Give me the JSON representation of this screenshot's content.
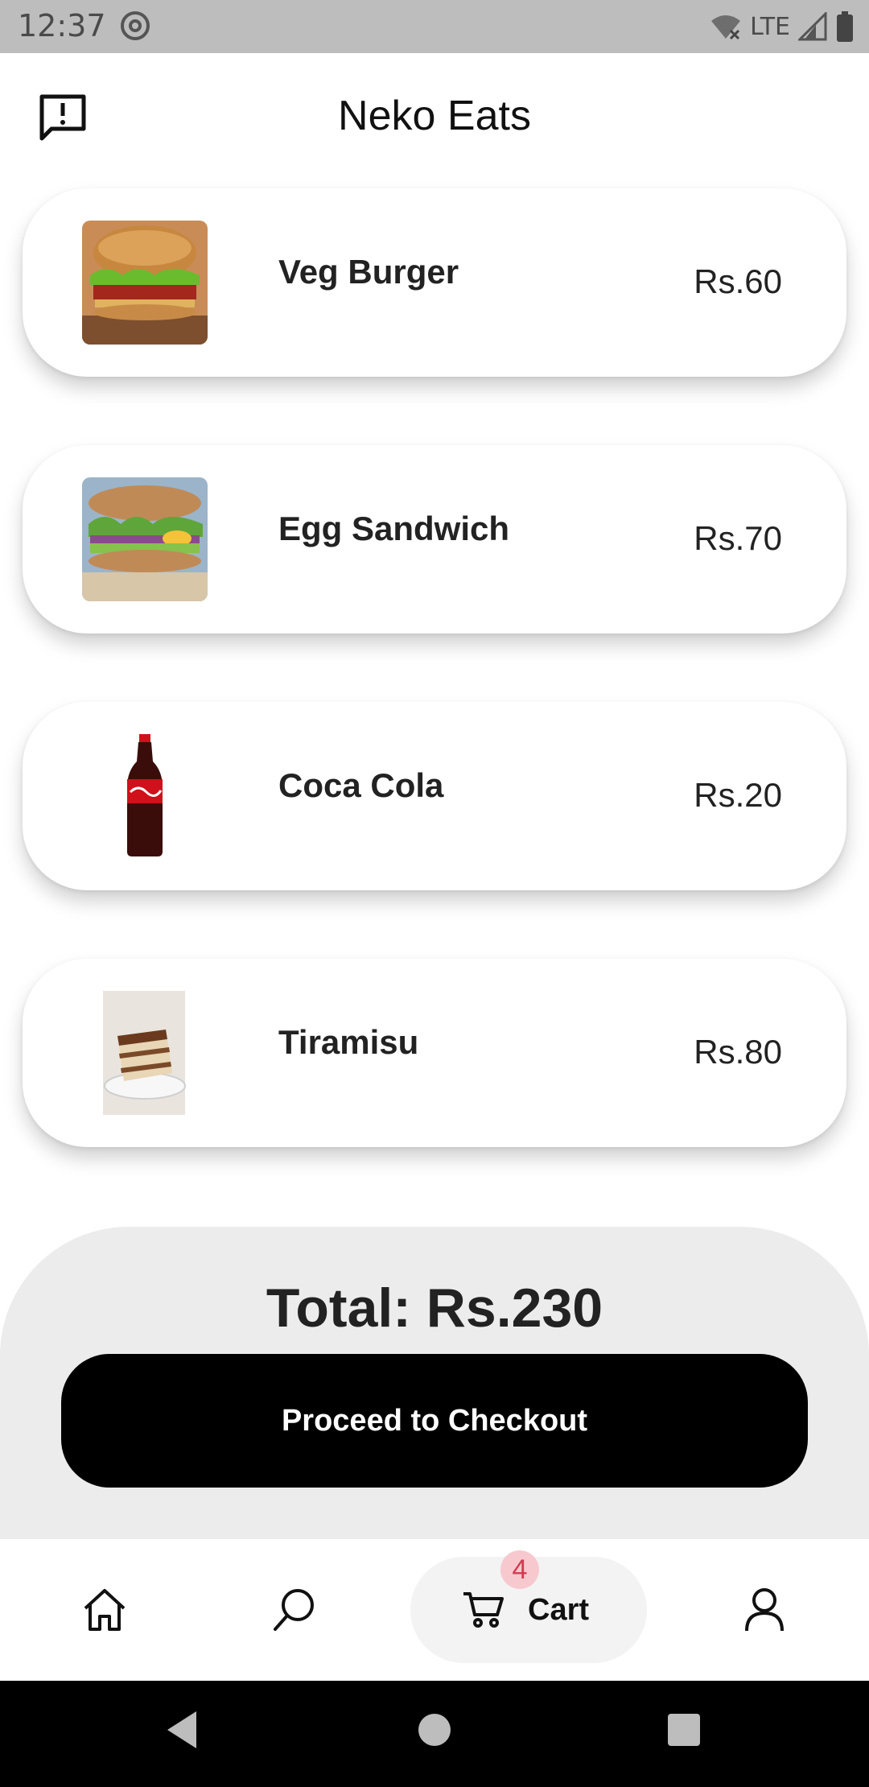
{
  "status_bar": {
    "time": "12:37",
    "network": "LTE"
  },
  "header": {
    "title": "Neko Eats",
    "feedback_icon": "feedback-icon"
  },
  "cart": {
    "items": [
      {
        "name": "Veg Burger",
        "price": "Rs.60"
      },
      {
        "name": "Egg Sandwich",
        "price": "Rs.70"
      },
      {
        "name": "Coca Cola",
        "price": "Rs.20"
      },
      {
        "name": "Tiramisu",
        "price": "Rs.80"
      }
    ]
  },
  "checkout": {
    "total": "Total: Rs.230",
    "button_label": "Proceed to Checkout"
  },
  "bottom_nav": {
    "home_icon": "home-icon",
    "search_icon": "search-icon",
    "cart_label": "Cart",
    "cart_badge": "4",
    "profile_icon": "profile-icon"
  },
  "colors": {
    "status_bar_bg": "#bdbdbd",
    "checkout_button": "#000000",
    "panel_bg": "#ececec",
    "badge_bg": "#f7c9cf",
    "badge_text": "#d43a4e"
  }
}
